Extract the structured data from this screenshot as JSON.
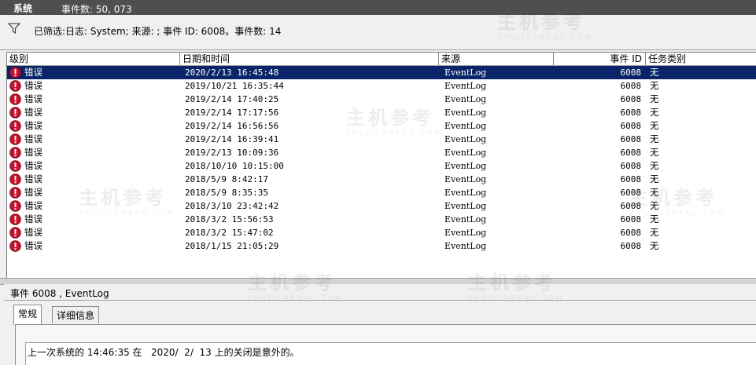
{
  "topbar": {
    "title": "系统",
    "event_count": "事件数: 50, 073"
  },
  "filter": {
    "text": "已筛选:日志: System; 来源: ; 事件 ID: 6008。事件数: 14"
  },
  "columns": [
    "级别",
    "日期和时间",
    "来源",
    "事件 ID",
    "任务类别"
  ],
  "rows": [
    {
      "level": "错误",
      "datetime": "2020/2/13 16:45:48",
      "source": "EventLog",
      "event_id": "6008",
      "category": "无"
    },
    {
      "level": "错误",
      "datetime": "2019/10/21 16:35:44",
      "source": "EventLog",
      "event_id": "6008",
      "category": "无"
    },
    {
      "level": "错误",
      "datetime": "2019/2/14 17:40:25",
      "source": "EventLog",
      "event_id": "6008",
      "category": "无"
    },
    {
      "level": "错误",
      "datetime": "2019/2/14 17:17:56",
      "source": "EventLog",
      "event_id": "6008",
      "category": "无"
    },
    {
      "level": "错误",
      "datetime": "2019/2/14 16:56:56",
      "source": "EventLog",
      "event_id": "6008",
      "category": "无"
    },
    {
      "level": "错误",
      "datetime": "2019/2/14 16:39:41",
      "source": "EventLog",
      "event_id": "6008",
      "category": "无"
    },
    {
      "level": "错误",
      "datetime": "2019/2/13 10:09:36",
      "source": "EventLog",
      "event_id": "6008",
      "category": "无"
    },
    {
      "level": "错误",
      "datetime": "2018/10/10 10:15:00",
      "source": "EventLog",
      "event_id": "6008",
      "category": "无"
    },
    {
      "level": "错误",
      "datetime": "2018/5/9 8:42:17",
      "source": "EventLog",
      "event_id": "6008",
      "category": "无"
    },
    {
      "level": "错误",
      "datetime": "2018/5/9 8:35:35",
      "source": "EventLog",
      "event_id": "6008",
      "category": "无"
    },
    {
      "level": "错误",
      "datetime": "2018/3/10 23:42:42",
      "source": "EventLog",
      "event_id": "6008",
      "category": "无"
    },
    {
      "level": "错误",
      "datetime": "2018/3/2 15:56:53",
      "source": "EventLog",
      "event_id": "6008",
      "category": "无"
    },
    {
      "level": "错误",
      "datetime": "2018/3/2 15:47:02",
      "source": "EventLog",
      "event_id": "6008",
      "category": "无"
    },
    {
      "level": "错误",
      "datetime": "2018/1/15 21:05:29",
      "source": "EventLog",
      "event_id": "6008",
      "category": "无"
    }
  ],
  "detail": {
    "header": "事件 6008 , EventLog",
    "tabs": [
      "常规",
      "详细信息"
    ],
    "message": "上一次系统的 14:46:35 在   2020/  2/  13 上的关闭是意外的。"
  },
  "watermark": {
    "main": "主机参考",
    "sub": "ZHUJICANKAO.COM"
  },
  "icons": {
    "filter": "funnel-icon",
    "level": "error-icon"
  },
  "colors": {
    "selected_row": "#0a246a",
    "error_icon": "#c8102e",
    "topbar": "#4f4f4f"
  }
}
